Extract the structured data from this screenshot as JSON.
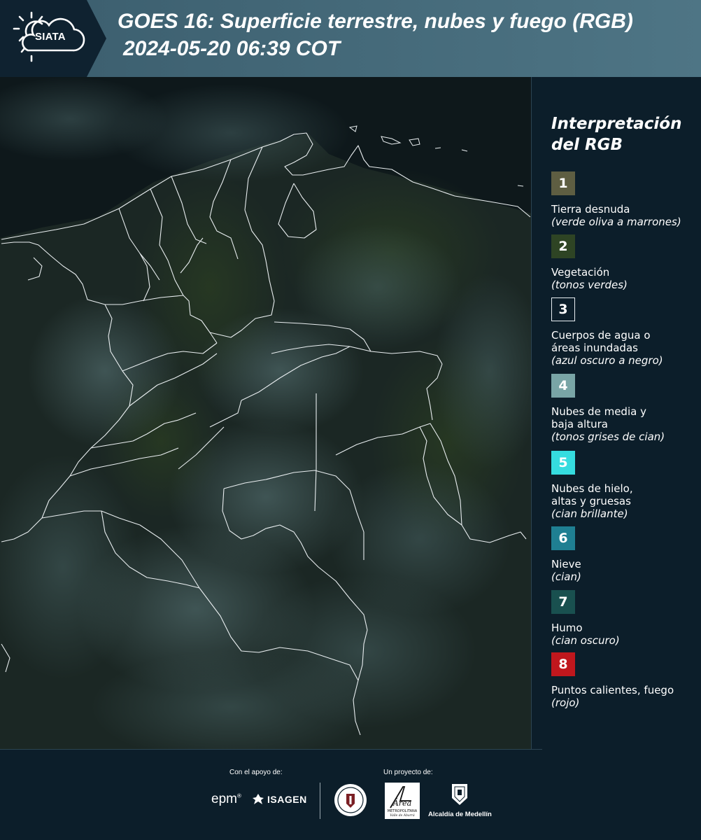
{
  "header": {
    "logo_text": "SIATA",
    "title_line1": "GOES 16: Superficie terrestre, nubes y fuego (RGB)",
    "title_line2": "2024-05-20 06:39 COT"
  },
  "legend": {
    "title_line1": "Interpretación",
    "title_line2": "del RGB",
    "items": [
      {
        "number": "1",
        "color": "#5e5e42",
        "label": "Tierra desnuda",
        "note": "(verde oliva a marrones)"
      },
      {
        "number": "2",
        "color": "#2e4424",
        "label": "Vegetación",
        "note": "(tonos verdes)"
      },
      {
        "number": "3",
        "color": "#0c1e2a",
        "label": "Cuerpos de agua o áreas inundadas",
        "note": "(azul oscuro a negro)"
      },
      {
        "number": "4",
        "color": "#79a5a6",
        "label": "Nubes de media y baja altura",
        "note": "(tonos grises de cian)"
      },
      {
        "number": "5",
        "color": "#35dcdf",
        "label": "Nubes de hielo, altas y gruesas",
        "note": "(cian brillante)"
      },
      {
        "number": "6",
        "color": "#1f7f92",
        "label": "Nieve",
        "note": "(cian)"
      },
      {
        "number": "7",
        "color": "#19504f",
        "label": "Humo",
        "note": "(cian oscuro)"
      },
      {
        "number": "8",
        "color": "#c0171d",
        "label": "Puntos calientes, fuego",
        "note": "(rojo)"
      }
    ]
  },
  "footer": {
    "support_label": "Con el apoyo de:",
    "project_label": "Un proyecto de:",
    "epm": "epm",
    "isagen": "ISAGEN",
    "amva_name": "Área",
    "amva_sub": "METROPOLITANA",
    "amva_tag": "Valle de Aburrá",
    "alcaldia": "Alcaldía de Medellín"
  }
}
